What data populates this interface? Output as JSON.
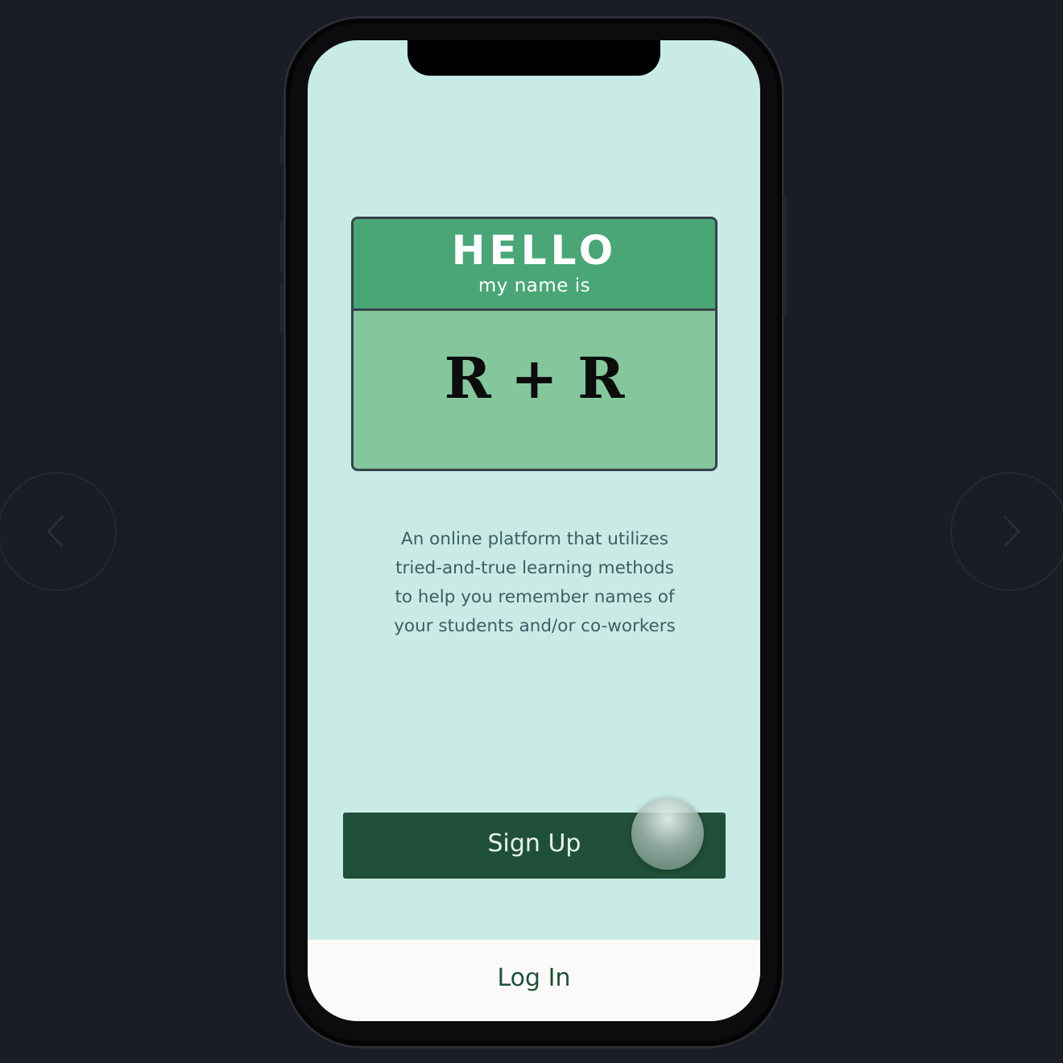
{
  "nametag": {
    "hello": "HELLO",
    "subtitle": "my name is",
    "name": "R + R"
  },
  "description": "An online platform that utilizes tried-and-true learning methods to help you remember names of your students and/or co-workers",
  "signup_label": "Sign Up",
  "login_label": "Log In",
  "colors": {
    "background": "#1a1c26",
    "screen": "#c8ebe6",
    "tag_header": "#4aa677",
    "tag_body": "#84c79c",
    "signup_button": "#21503a",
    "login_bar": "#fbfaf8"
  },
  "icons": {
    "previous": "chevron-left-icon",
    "next": "chevron-right-icon"
  }
}
